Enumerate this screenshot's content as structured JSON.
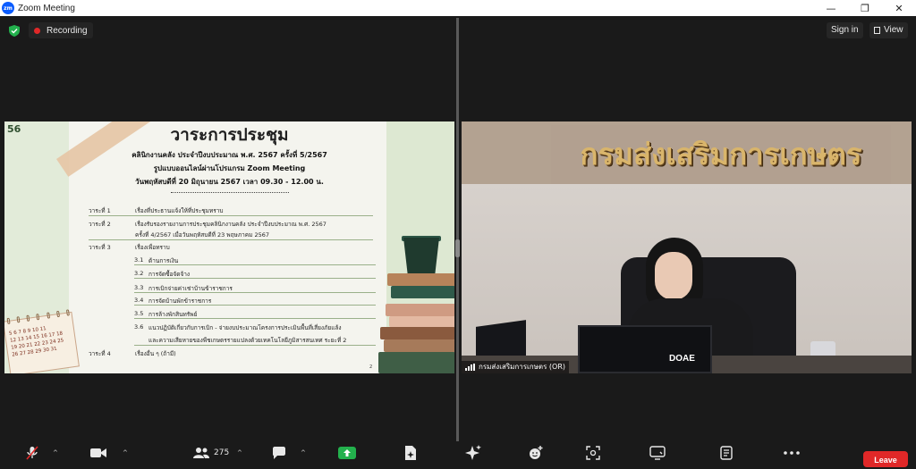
{
  "window": {
    "title": "Zoom Meeting",
    "logo_text": "zm",
    "minimize": "—",
    "restore": "❐",
    "close": "✕"
  },
  "topbar": {
    "recording_label": "Recording",
    "signin_label": "Sign in",
    "view_label": "View"
  },
  "slide": {
    "logo": "56",
    "title": "วาระการประชุม",
    "line1": "คลินิกงานคลัง ประจำปีงบประมาณ พ.ศ. 2567 ครั้งที่ 5/2567",
    "line2": "รูปแบบออนไลน์ผ่านโปรแกรม Zoom Meeting",
    "line3": "วันพฤหัสบดีที่ 20 มิถุนายน 2567 เวลา 09.30 - 12.00 น.",
    "agenda": [
      {
        "num": "วาระที่ 1",
        "text": "เรื่องที่ประธานแจ้งให้ที่ประชุมทราบ"
      },
      {
        "num": "วาระที่ 2",
        "text": "เรื่องรับรองรายงานการประชุมคลินิกงานคลัง ประจำปีงบประมาณ พ.ศ. 2567"
      },
      {
        "num": "",
        "text": "ครั้งที่ 4/2567 เมื่อวันพฤหัสบดีที่ 23 พฤษภาคม 2567"
      },
      {
        "num": "วาระที่ 3",
        "text": "เรื่องเพื่อทราบ"
      }
    ],
    "subitems": [
      {
        "n": "3.1",
        "t": "ด้านการเงิน"
      },
      {
        "n": "3.2",
        "t": "การจัดซื้อจัดจ้าง"
      },
      {
        "n": "3.3",
        "t": "การเบิกจ่ายค่าเช่าบ้านข้าราชการ"
      },
      {
        "n": "3.4",
        "t": "การจัดบ้านพักข้าราชการ"
      },
      {
        "n": "3.5",
        "t": "การล้างพักสินทรัพย์"
      },
      {
        "n": "3.6",
        "t": "แนวปฏิบัติเกี่ยวกับการเบิก - จ่ายงบประมาณโครงการประเมินพื้นที่เสี่ยงภัยแล้ง"
      },
      {
        "n": "",
        "t": "และความเสียหายของพืชเกษตรรายแปลงด้วยเทคโนโลยีภูมิสารสนเทศ ระยะที่ 2"
      }
    ],
    "agenda4": {
      "num": "วาระที่ 4",
      "text": "เรื่องอื่น ๆ (ถ้ามี)"
    },
    "page_no": "2",
    "calendar_rows": [
      "5 6 7 8 9 10 11",
      "12 13 14 15 16 17 18",
      "19 20 21 22 23 24 25",
      "26 27 28 29 30 31"
    ]
  },
  "video": {
    "sign_text": "กรมส่งเสริมการเกษตร",
    "nameplate": "DOAE",
    "participant_label": "กรมส่งเสริมการเกษตร (OR)"
  },
  "toolbar": {
    "participants_count": "275",
    "leave_label": "Leave"
  }
}
